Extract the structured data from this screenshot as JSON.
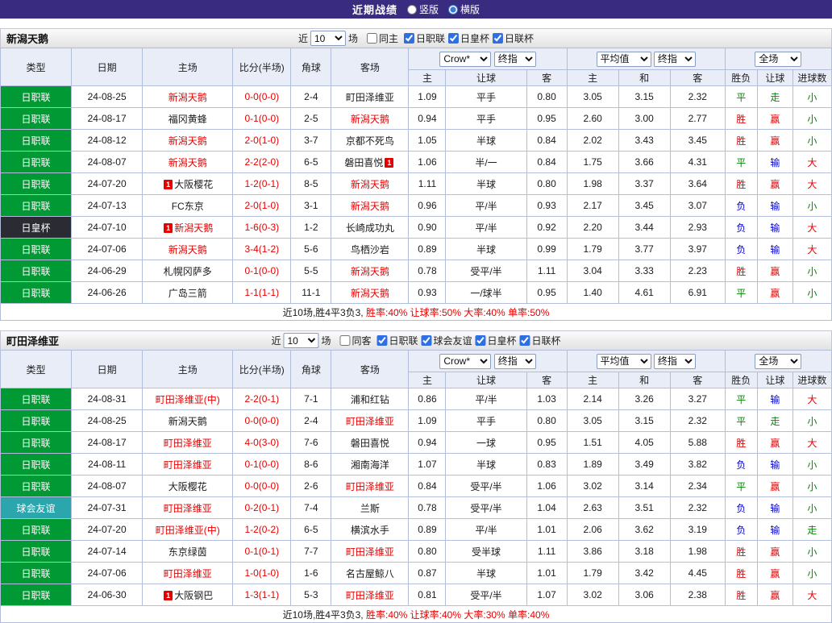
{
  "topbar": {
    "title": "近期战绩",
    "layout_options": [
      {
        "label": "竖版",
        "selected": false
      },
      {
        "label": "横版",
        "selected": true
      }
    ]
  },
  "labels": {
    "near": "近",
    "count": "10",
    "matches": "场"
  },
  "selects": {
    "company": "Crow*",
    "time": "终指",
    "average": "平均值",
    "full": "全场"
  },
  "columns": {
    "type": "类型",
    "date": "日期",
    "home": "主场",
    "score": "比分(半场)",
    "corner": "角球",
    "away": "客场",
    "host": "主",
    "handicap": "让球",
    "guest": "客",
    "avg_host": "主",
    "avg_draw": "和",
    "avg_guest": "客",
    "result": "胜负",
    "handicap_result": "让球",
    "goals": "进球数"
  },
  "colors": {
    "topbar_bg": "#392b7f",
    "accent_blue": "#2f6fe4",
    "red": "#e60000",
    "border": "#b2bddc",
    "league_bg": {
      "日职联": "#009933",
      "日皇杯": "#2b2b33",
      "球会友谊": "#2aa6ac"
    },
    "outcome_text": {
      "胜": "#e60000",
      "赢": "#e60000",
      "大": "#e60000",
      "平": "#008800",
      "走": "#008800",
      "小": "#008800",
      "负": "#0000cc",
      "输": "#0000cc"
    }
  },
  "sections": [
    {
      "team": "新潟天鹅",
      "filters": {
        "same": "同主",
        "leagues": [
          "日职联",
          "日皇杯",
          "日联杯"
        ]
      },
      "rows": [
        {
          "league": "日职联",
          "date": "24-08-25",
          "home": {
            "name": "新潟天鹅",
            "focus": true
          },
          "score": "0-0(0-0)",
          "corner": "2-4",
          "away": {
            "name": "町田泽维亚"
          },
          "odds": [
            "1.09",
            "平手",
            "0.80"
          ],
          "avg": [
            "3.05",
            "3.15",
            "2.32"
          ],
          "outcome": [
            "平",
            "走",
            "小"
          ]
        },
        {
          "league": "日职联",
          "date": "24-08-17",
          "home": {
            "name": "福冈黄蜂"
          },
          "score": "0-1(0-0)",
          "corner": "2-5",
          "away": {
            "name": "新潟天鹅",
            "focus": true
          },
          "odds": [
            "0.94",
            "平手",
            "0.95"
          ],
          "avg": [
            "2.60",
            "3.00",
            "2.77"
          ],
          "outcome": [
            "胜",
            "赢",
            "小"
          ]
        },
        {
          "league": "日职联",
          "date": "24-08-12",
          "home": {
            "name": "新潟天鹅",
            "focus": true
          },
          "score": "2-0(1-0)",
          "corner": "3-7",
          "away": {
            "name": "京都不死鸟"
          },
          "odds": [
            "1.05",
            "半球",
            "0.84"
          ],
          "avg": [
            "2.02",
            "3.43",
            "3.45"
          ],
          "outcome": [
            "胜",
            "赢",
            "小"
          ]
        },
        {
          "league": "日职联",
          "date": "24-08-07",
          "home": {
            "name": "新潟天鹅",
            "focus": true
          },
          "score": "2-2(2-0)",
          "corner": "6-5",
          "away": {
            "name": "磐田喜悦",
            "card_after": "1"
          },
          "odds": [
            "1.06",
            "半/一",
            "0.84"
          ],
          "avg": [
            "1.75",
            "3.66",
            "4.31"
          ],
          "outcome": [
            "平",
            "输",
            "大"
          ]
        },
        {
          "league": "日职联",
          "date": "24-07-20",
          "home": {
            "name": "大阪樱花",
            "card_before": "1"
          },
          "score": "1-2(0-1)",
          "corner": "8-5",
          "away": {
            "name": "新潟天鹅",
            "focus": true
          },
          "odds": [
            "1.11",
            "半球",
            "0.80"
          ],
          "avg": [
            "1.98",
            "3.37",
            "3.64"
          ],
          "outcome": [
            "胜",
            "赢",
            "大"
          ]
        },
        {
          "league": "日职联",
          "date": "24-07-13",
          "home": {
            "name": "FC东京"
          },
          "score": "2-0(1-0)",
          "corner": "3-1",
          "away": {
            "name": "新潟天鹅",
            "focus": true
          },
          "odds": [
            "0.96",
            "平/半",
            "0.93"
          ],
          "avg": [
            "2.17",
            "3.45",
            "3.07"
          ],
          "outcome": [
            "负",
            "输",
            "小"
          ]
        },
        {
          "league": "日皇杯",
          "date": "24-07-10",
          "home": {
            "name": "新潟天鹅",
            "focus": true,
            "card_before": "1"
          },
          "score": "1-6(0-3)",
          "corner": "1-2",
          "away": {
            "name": "长崎成功丸"
          },
          "odds": [
            "0.90",
            "平/半",
            "0.92"
          ],
          "avg": [
            "2.20",
            "3.44",
            "2.93"
          ],
          "outcome": [
            "负",
            "输",
            "大"
          ]
        },
        {
          "league": "日职联",
          "date": "24-07-06",
          "home": {
            "name": "新潟天鹅",
            "focus": true
          },
          "score": "3-4(1-2)",
          "corner": "5-6",
          "away": {
            "name": "鸟栖沙岩"
          },
          "odds": [
            "0.89",
            "半球",
            "0.99"
          ],
          "avg": [
            "1.79",
            "3.77",
            "3.97"
          ],
          "outcome": [
            "负",
            "输",
            "大"
          ]
        },
        {
          "league": "日职联",
          "date": "24-06-29",
          "home": {
            "name": "札幌冈萨多"
          },
          "score": "0-1(0-0)",
          "corner": "5-5",
          "away": {
            "name": "新潟天鹅",
            "focus": true
          },
          "odds": [
            "0.78",
            "受平/半",
            "1.11"
          ],
          "avg": [
            "3.04",
            "3.33",
            "2.23"
          ],
          "outcome": [
            "胜",
            "赢",
            "小"
          ]
        },
        {
          "league": "日职联",
          "date": "24-06-26",
          "home": {
            "name": "广岛三箭"
          },
          "score": "1-1(1-1)",
          "corner": "11-1",
          "away": {
            "name": "新潟天鹅",
            "focus": true
          },
          "odds": [
            "0.93",
            "一/球半",
            "0.95"
          ],
          "avg": [
            "1.40",
            "4.61",
            "6.91"
          ],
          "outcome": [
            "平",
            "赢",
            "小"
          ]
        }
      ],
      "summary": {
        "prefix": "近10场,胜4平3负3,",
        "stats": "胜率:40%  让球率:50%  大率:40%  单率:50%"
      }
    },
    {
      "team": "町田泽维亚",
      "filters": {
        "same": "同客",
        "leagues": [
          "日职联",
          "球会友谊",
          "日皇杯",
          "日联杯"
        ]
      },
      "rows": [
        {
          "league": "日职联",
          "date": "24-08-31",
          "home": {
            "name": "町田泽维亚(中)",
            "focus": true
          },
          "score": "2-2(0-1)",
          "corner": "7-1",
          "away": {
            "name": "浦和红钻"
          },
          "odds": [
            "0.86",
            "平/半",
            "1.03"
          ],
          "avg": [
            "2.14",
            "3.26",
            "3.27"
          ],
          "outcome": [
            "平",
            "输",
            "大"
          ]
        },
        {
          "league": "日职联",
          "date": "24-08-25",
          "home": {
            "name": "新潟天鹅"
          },
          "score": "0-0(0-0)",
          "corner": "2-4",
          "away": {
            "name": "町田泽维亚",
            "focus": true
          },
          "odds": [
            "1.09",
            "平手",
            "0.80"
          ],
          "avg": [
            "3.05",
            "3.15",
            "2.32"
          ],
          "outcome": [
            "平",
            "走",
            "小"
          ]
        },
        {
          "league": "日职联",
          "date": "24-08-17",
          "home": {
            "name": "町田泽维亚",
            "focus": true
          },
          "score": "4-0(3-0)",
          "corner": "7-6",
          "away": {
            "name": "磐田喜悦"
          },
          "odds": [
            "0.94",
            "一球",
            "0.95"
          ],
          "avg": [
            "1.51",
            "4.05",
            "5.88"
          ],
          "outcome": [
            "胜",
            "赢",
            "大"
          ]
        },
        {
          "league": "日职联",
          "date": "24-08-11",
          "home": {
            "name": "町田泽维亚",
            "focus": true
          },
          "score": "0-1(0-0)",
          "corner": "8-6",
          "away": {
            "name": "湘南海洋"
          },
          "odds": [
            "1.07",
            "半球",
            "0.83"
          ],
          "avg": [
            "1.89",
            "3.49",
            "3.82"
          ],
          "outcome": [
            "负",
            "输",
            "小"
          ]
        },
        {
          "league": "日职联",
          "date": "24-08-07",
          "home": {
            "name": "大阪樱花"
          },
          "score": "0-0(0-0)",
          "corner": "2-6",
          "away": {
            "name": "町田泽维亚",
            "focus": true
          },
          "odds": [
            "0.84",
            "受平/半",
            "1.06"
          ],
          "avg": [
            "3.02",
            "3.14",
            "2.34"
          ],
          "outcome": [
            "平",
            "赢",
            "小"
          ]
        },
        {
          "league": "球会友谊",
          "date": "24-07-31",
          "home": {
            "name": "町田泽维亚",
            "focus": true
          },
          "score": "0-2(0-1)",
          "corner": "7-4",
          "away": {
            "name": "兰斯"
          },
          "odds": [
            "0.78",
            "受平/半",
            "1.04"
          ],
          "avg": [
            "2.63",
            "3.51",
            "2.32"
          ],
          "outcome": [
            "负",
            "输",
            "小"
          ]
        },
        {
          "league": "日职联",
          "date": "24-07-20",
          "home": {
            "name": "町田泽维亚(中)",
            "focus": true
          },
          "score": "1-2(0-2)",
          "corner": "6-5",
          "away": {
            "name": "横滨水手"
          },
          "odds": [
            "0.89",
            "平/半",
            "1.01"
          ],
          "avg": [
            "2.06",
            "3.62",
            "3.19"
          ],
          "outcome": [
            "负",
            "输",
            "走"
          ]
        },
        {
          "league": "日职联",
          "date": "24-07-14",
          "home": {
            "name": "东京绿茵"
          },
          "score": "0-1(0-1)",
          "corner": "7-7",
          "away": {
            "name": "町田泽维亚",
            "focus": true
          },
          "odds": [
            "0.80",
            "受半球",
            "1.11"
          ],
          "avg": [
            "3.86",
            "3.18",
            "1.98"
          ],
          "outcome": [
            "胜",
            "赢",
            "小"
          ]
        },
        {
          "league": "日职联",
          "date": "24-07-06",
          "home": {
            "name": "町田泽维亚",
            "focus": true
          },
          "score": "1-0(1-0)",
          "corner": "1-6",
          "away": {
            "name": "名古屋鲸八"
          },
          "odds": [
            "0.87",
            "半球",
            "1.01"
          ],
          "avg": [
            "1.79",
            "3.42",
            "4.45"
          ],
          "outcome": [
            "胜",
            "赢",
            "小"
          ]
        },
        {
          "league": "日职联",
          "date": "24-06-30",
          "home": {
            "name": "大阪钢巴",
            "card_before": "1"
          },
          "score": "1-3(1-1)",
          "corner": "5-3",
          "away": {
            "name": "町田泽维亚",
            "focus": true
          },
          "odds": [
            "0.81",
            "受平/半",
            "1.07"
          ],
          "avg": [
            "3.02",
            "3.06",
            "2.38"
          ],
          "outcome": [
            "胜",
            "赢",
            "大"
          ]
        }
      ],
      "summary": {
        "prefix": "近10场,胜4平3负3,",
        "stats": "胜率:40%  让球率:40%  大率:30%  单率:40%"
      }
    }
  ]
}
